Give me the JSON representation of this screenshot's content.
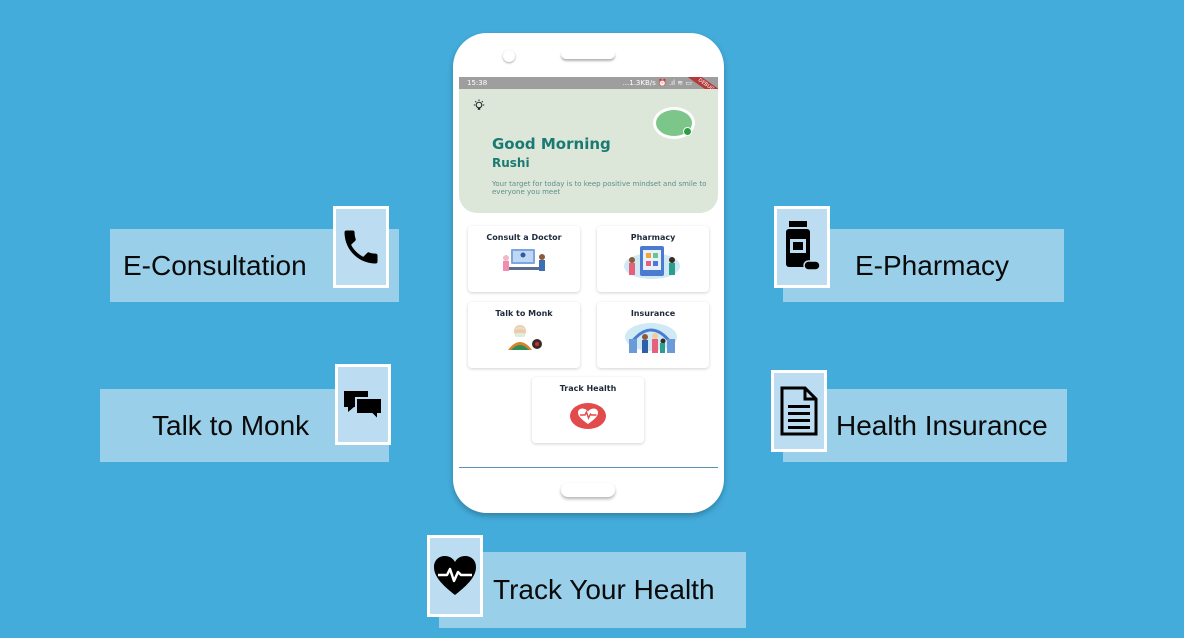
{
  "features": {
    "econsultation": {
      "label": "E-Consultation",
      "icon": "phone-icon"
    },
    "talk_to_monk": {
      "label": "Talk to Monk",
      "icon": "chat-bubbles-icon"
    },
    "track_health": {
      "label": "Track Your Health",
      "icon": "heart-pulse-icon"
    },
    "epharmacy": {
      "label": "E-Pharmacy",
      "icon": "medicine-bottle-icon"
    },
    "health_insurance": {
      "label": "Health Insurance",
      "icon": "document-icon"
    }
  },
  "phone": {
    "status": {
      "time": "15:38",
      "stats": "...1.3KB/s ⏰ .ıl ≋ ▭"
    },
    "debug_banner": "DEBUG",
    "greeting": {
      "title": "Good Morning",
      "name": "Rushi",
      "message": "Your target for today is to keep positive mindset and smile to everyone you meet"
    },
    "cards": [
      {
        "label": "Consult a Doctor"
      },
      {
        "label": "Pharmacy"
      },
      {
        "label": "Talk to Monk"
      },
      {
        "label": "Insurance"
      },
      {
        "label": "Track Health"
      }
    ]
  },
  "colors": {
    "background": "#43ACDB",
    "feature_box": "#9ACFEA",
    "icon_box": "#BCDDF1",
    "greeting_bg": "#DCE7DA",
    "accent_teal": "#1A7A72"
  }
}
